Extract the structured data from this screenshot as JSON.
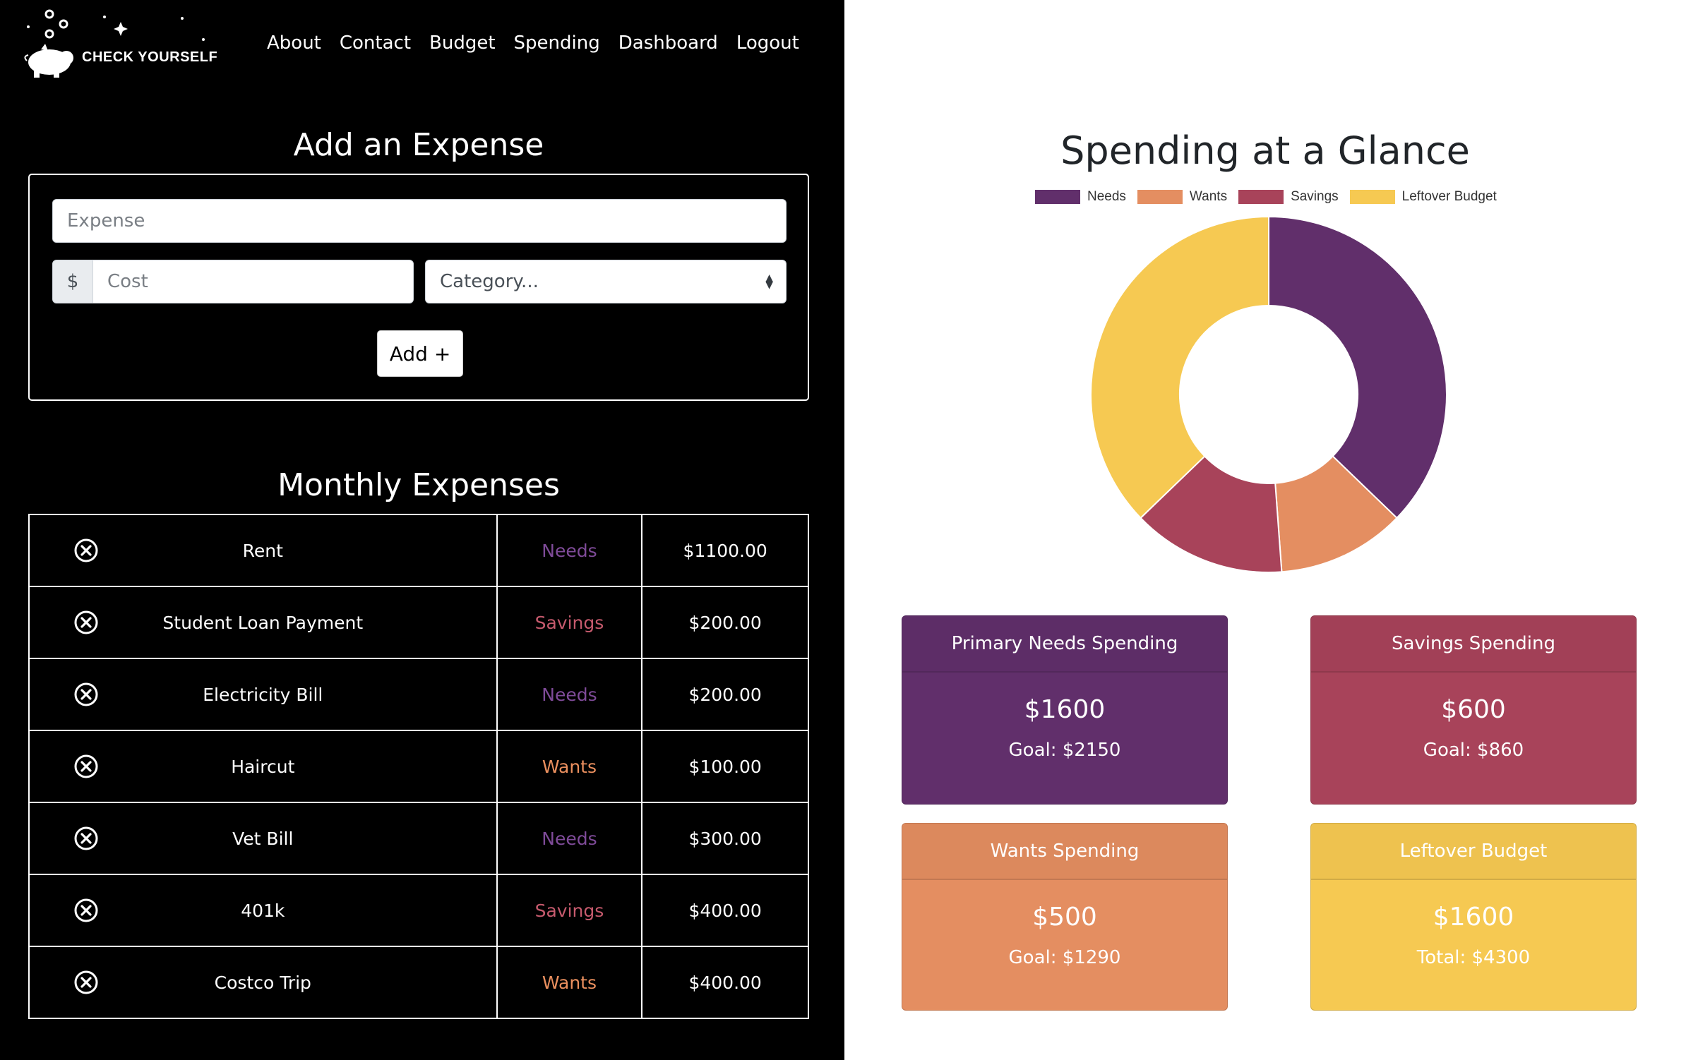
{
  "brand": {
    "name": "CHECK YOURSELF"
  },
  "nav": [
    "About",
    "Contact",
    "Budget",
    "Spending",
    "Dashboard",
    "Logout"
  ],
  "add_expense": {
    "title": "Add an Expense",
    "expense_placeholder": "Expense",
    "currency_symbol": "$",
    "cost_placeholder": "Cost",
    "category_placeholder": "Category...",
    "add_button": "Add +"
  },
  "monthly": {
    "title": "Monthly Expenses",
    "rows": [
      {
        "name": "Rent",
        "category": "Needs",
        "amount": "$1100.00"
      },
      {
        "name": "Student Loan Payment",
        "category": "Savings",
        "amount": "$200.00"
      },
      {
        "name": "Electricity Bill",
        "category": "Needs",
        "amount": "$200.00"
      },
      {
        "name": "Haircut",
        "category": "Wants",
        "amount": "$100.00"
      },
      {
        "name": "Vet Bill",
        "category": "Needs",
        "amount": "$300.00"
      },
      {
        "name": "401k",
        "category": "Savings",
        "amount": "$400.00"
      },
      {
        "name": "Costco Trip",
        "category": "Wants",
        "amount": "$400.00"
      }
    ]
  },
  "chart_data": {
    "type": "pie",
    "title": "Spending at a Glance",
    "categories": [
      "Needs",
      "Wants",
      "Savings",
      "Leftover Budget"
    ],
    "values": [
      1600,
      500,
      600,
      1600
    ],
    "colors": [
      "#612f6b",
      "#e48e61",
      "#a8435a",
      "#f6c952"
    ],
    "legend": "top"
  },
  "cards": {
    "needs": {
      "title": "Primary Needs Spending",
      "amount": "$1600",
      "goal": "Goal: $2150"
    },
    "savings": {
      "title": "Savings Spending",
      "amount": "$600",
      "goal": "Goal: $860"
    },
    "wants": {
      "title": "Wants Spending",
      "amount": "$500",
      "goal": "Goal: $1290"
    },
    "leftover": {
      "title": "Leftover Budget",
      "amount": "$1600",
      "goal": "Total: $4300"
    }
  },
  "colors": {
    "needs": "#612f6b",
    "wants": "#e48e61",
    "savings": "#a8435a",
    "leftover": "#f6c952",
    "needs_text": "#7f4b99",
    "savings_text": "#c65a6d",
    "wants_text": "#ea8f5e"
  }
}
